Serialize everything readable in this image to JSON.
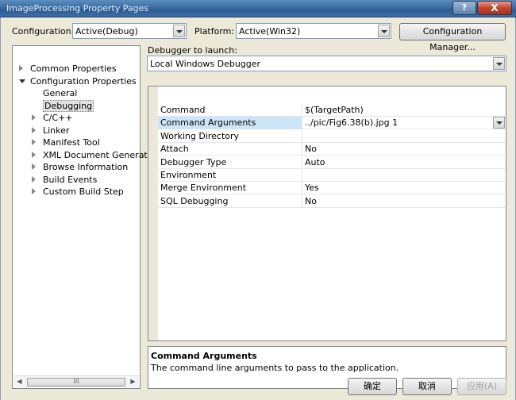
{
  "window": {
    "title": "ImageProcessing Property Pages",
    "help_label": "?",
    "close_label": "X"
  },
  "toolbar": {
    "configuration_label": "Configuration:",
    "configuration_value": "Active(Debug)",
    "platform_label": "Platform:",
    "platform_value": "Active(Win32)",
    "config_manager_label": "Configuration Manager..."
  },
  "tree": {
    "items": [
      {
        "label": "Common Properties",
        "level": 0,
        "expander": "closed"
      },
      {
        "label": "Configuration Properties",
        "level": 0,
        "expander": "open"
      },
      {
        "label": "General",
        "level": 1,
        "expander": "none"
      },
      {
        "label": "Debugging",
        "level": 1,
        "expander": "none",
        "selected": true
      },
      {
        "label": "C/C++",
        "level": 1,
        "expander": "closed"
      },
      {
        "label": "Linker",
        "level": 1,
        "expander": "closed"
      },
      {
        "label": "Manifest Tool",
        "level": 1,
        "expander": "closed"
      },
      {
        "label": "XML Document Generator",
        "level": 1,
        "expander": "closed"
      },
      {
        "label": "Browse Information",
        "level": 1,
        "expander": "closed"
      },
      {
        "label": "Build Events",
        "level": 1,
        "expander": "closed"
      },
      {
        "label": "Custom Build Step",
        "level": 1,
        "expander": "closed"
      }
    ],
    "scroll_left_icon": "◀",
    "scroll_right_icon": "▶",
    "scroll_grip": "III"
  },
  "debugger": {
    "label": "Debugger to launch:",
    "value": "Local Windows Debugger"
  },
  "properties": [
    {
      "name": "Command",
      "value": "$(TargetPath)"
    },
    {
      "name": "Command Arguments",
      "value": "../pic/Fig6.38(b).jpg 1",
      "selected": true
    },
    {
      "name": "Working Directory",
      "value": ""
    },
    {
      "name": "Attach",
      "value": "No"
    },
    {
      "name": "Debugger Type",
      "value": "Auto"
    },
    {
      "name": "Environment",
      "value": ""
    },
    {
      "name": "Merge Environment",
      "value": "Yes"
    },
    {
      "name": "SQL Debugging",
      "value": "No"
    }
  ],
  "description": {
    "title": "Command Arguments",
    "text": "The command line arguments to pass to the application."
  },
  "buttons": {
    "ok": "确定",
    "cancel": "取消",
    "apply": "应用(A)"
  }
}
